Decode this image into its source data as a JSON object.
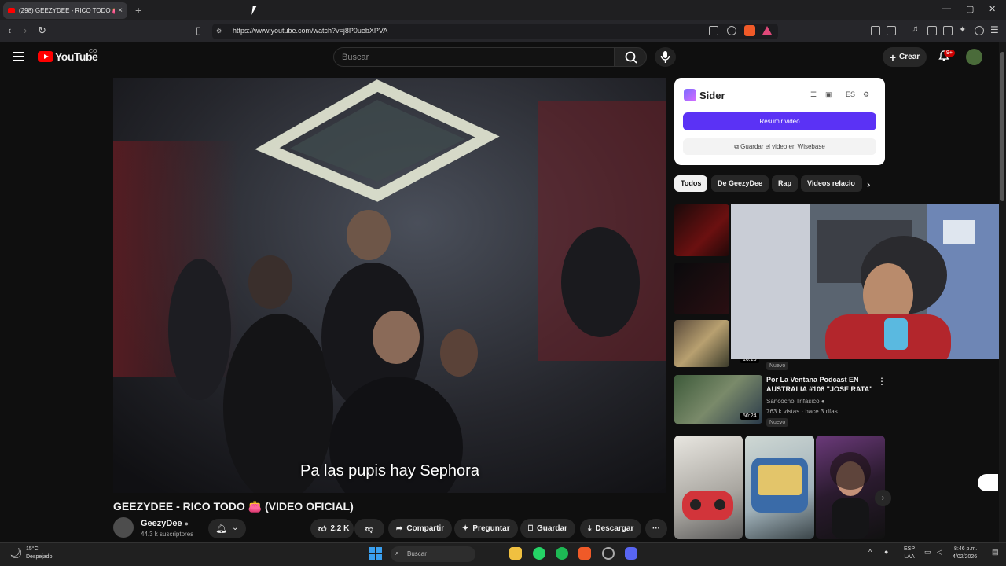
{
  "browser": {
    "tab_title": "(298) GEEZYDEE - RICO TODO 👛 -",
    "tab_close": "×",
    "new_tab": "+",
    "url": "https://www.youtube.com/watch?v=j8P0uebXPVA",
    "window_buttons": [
      "—",
      "▢",
      "✕"
    ]
  },
  "header": {
    "logo_text": "YouTube",
    "logo_sup": "CO",
    "search_placeholder": "Buscar",
    "create_label": "Crear",
    "create_icon": "+",
    "notif_badge": "9+"
  },
  "player": {
    "subtitle": "Pa las pupis hay Sephora",
    "title": "GEEZYDEE - RICO TODO 👛 (VIDEO OFICIAL)",
    "channel_name": "GeezyDee",
    "channel_subs": "44.3 k suscriptores",
    "likes": "2.2 K",
    "share_label": "Compartir",
    "ask_label": "Preguntar",
    "save_label": "Guardar",
    "download_label": "Descargar",
    "more_label": "···"
  },
  "sider": {
    "name": "Sider",
    "lang": "ES",
    "summarize_label": "Resumir video",
    "save_wisebase_label": "Guardar el video en Wisebase"
  },
  "chips": [
    "Todos",
    "De GeezyDee",
    "Rap",
    "Videos relacio"
  ],
  "related": [
    {
      "duration": "16:15",
      "badge": "Nuevo"
    },
    {
      "title": "Por La Ventana Podcast EN AUSTRALIA #108 \"JOSE RATA\"",
      "channel": "Sancocho Trifásico",
      "meta": "763 k vistas · hace 3 días",
      "duration": "50:24",
      "badge": "Nuevo"
    }
  ],
  "taskbar": {
    "temp": "15°C",
    "weather": "Despejado",
    "search_label": "Buscar",
    "lang1": "ESP",
    "lang2": "LAA",
    "time": "8:46 p.m.",
    "date": "4/02/2026"
  }
}
